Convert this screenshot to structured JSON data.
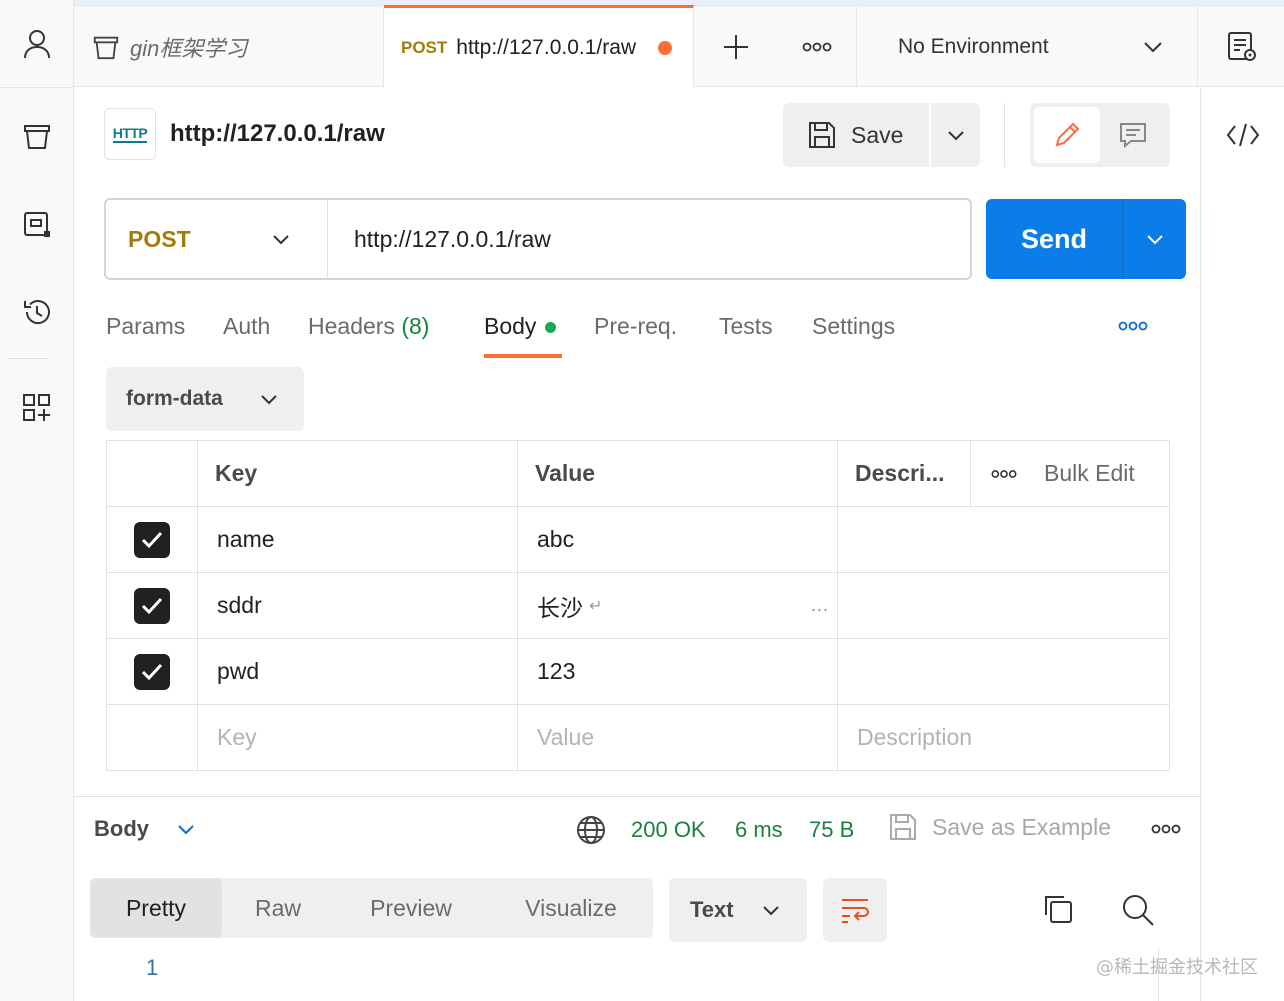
{
  "workspace": {
    "collection_name": "gin框架学习"
  },
  "tabs": [
    {
      "method": "POST",
      "url": "http://127.0.0.1/raw",
      "unsaved": true
    }
  ],
  "environment": {
    "selected": "No Environment"
  },
  "request": {
    "badge": "HTTP",
    "title": "http://127.0.0.1/raw",
    "save_label": "Save",
    "method": "POST",
    "url": "http://127.0.0.1/raw",
    "send_label": "Send"
  },
  "request_tabs": [
    {
      "label": "Params"
    },
    {
      "label": "Auth"
    },
    {
      "label": "Headers",
      "count": "(8)"
    },
    {
      "label": "Body",
      "active": true
    },
    {
      "label": "Pre-req."
    },
    {
      "label": "Tests"
    },
    {
      "label": "Settings"
    }
  ],
  "body": {
    "mode": "form-data",
    "columns": {
      "key": "Key",
      "value": "Value",
      "description": "Descri...",
      "bulk_edit": "Bulk Edit"
    },
    "rows": [
      {
        "checked": true,
        "key": "name",
        "value": "abc"
      },
      {
        "checked": true,
        "key": "sddr",
        "value": "长沙",
        "newline_glyph": "↵",
        "more": "..."
      },
      {
        "checked": true,
        "key": "pwd",
        "value": "123"
      }
    ],
    "placeholder": {
      "key": "Key",
      "value": "Value",
      "description": "Description"
    }
  },
  "response": {
    "section_label": "Body",
    "status": "200 OK",
    "time": "6 ms",
    "size": "75 B",
    "save_example_label": "Save as Example",
    "view_tabs": [
      {
        "label": "Pretty",
        "active": true
      },
      {
        "label": "Raw"
      },
      {
        "label": "Preview"
      },
      {
        "label": "Visualize"
      }
    ],
    "format": "Text",
    "line_numbers": [
      "1"
    ]
  },
  "watermark": "@稀土掘金技术社区",
  "colors": {
    "accent": "#ff6c37",
    "send": "#0b7de8",
    "post": "#a37b0a",
    "status_ok": "#1b7f3f",
    "link_blue": "#0b6ad8"
  },
  "icons": [
    "user-icon",
    "trash-icon",
    "environment-icon",
    "history-icon",
    "apps-icon",
    "new-tab-icon",
    "more-icon",
    "chevron-down-icon",
    "env-quicklook-icon",
    "save-icon",
    "edit-icon",
    "comment-icon",
    "code-icon",
    "checkmark-icon",
    "globe-icon",
    "wrap-lines-icon",
    "copy-icon",
    "search-icon"
  ]
}
